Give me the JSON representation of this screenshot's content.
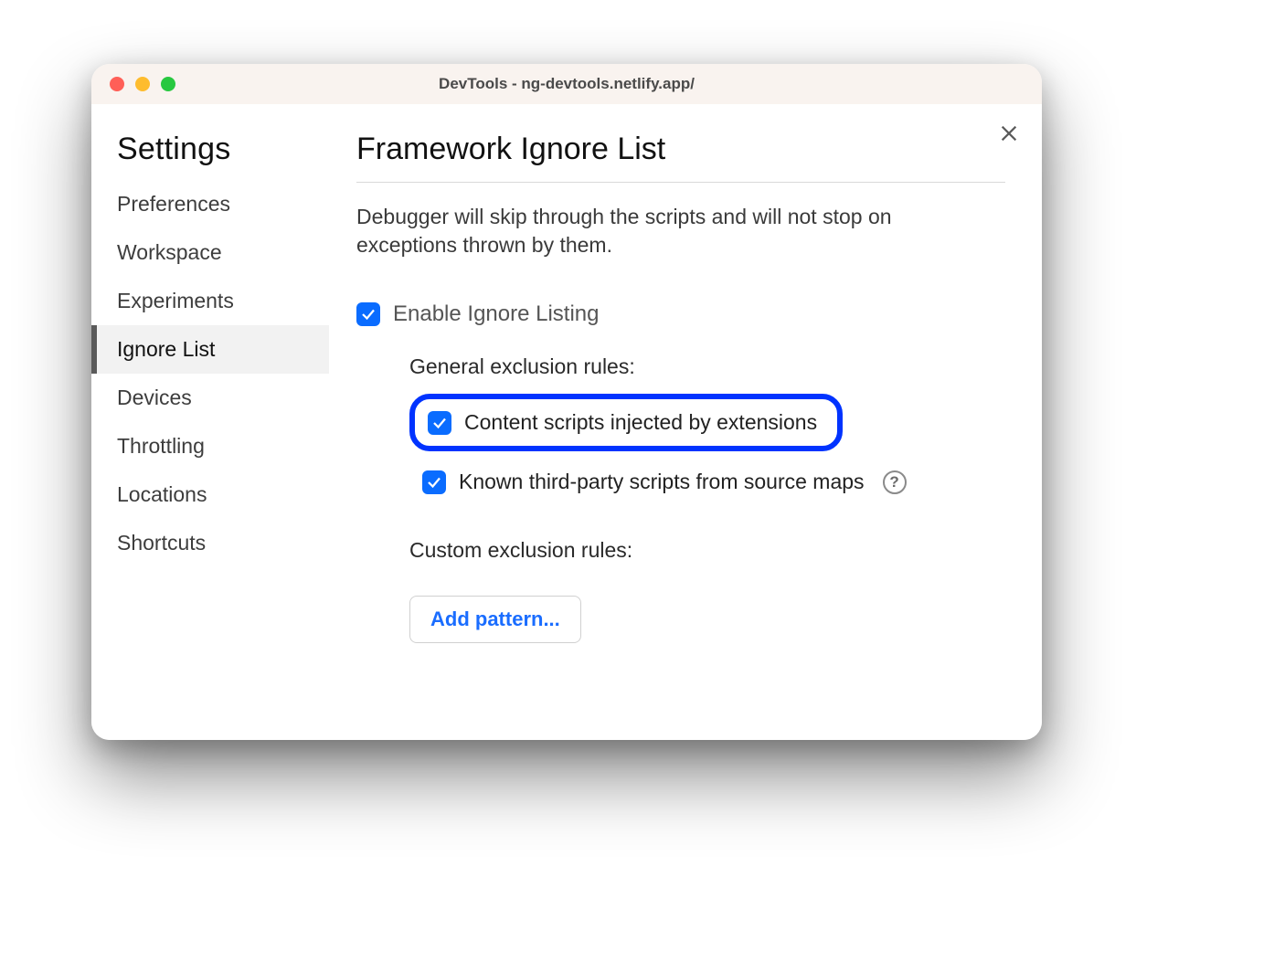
{
  "window": {
    "title": "DevTools - ng-devtools.netlify.app/"
  },
  "sidebar": {
    "title": "Settings",
    "items": [
      {
        "label": "Preferences",
        "active": false
      },
      {
        "label": "Workspace",
        "active": false
      },
      {
        "label": "Experiments",
        "active": false
      },
      {
        "label": "Ignore List",
        "active": true
      },
      {
        "label": "Devices",
        "active": false
      },
      {
        "label": "Throttling",
        "active": false
      },
      {
        "label": "Locations",
        "active": false
      },
      {
        "label": "Shortcuts",
        "active": false
      }
    ]
  },
  "main": {
    "title": "Framework Ignore List",
    "description": "Debugger will skip through the scripts and will not stop on exceptions thrown by them.",
    "enable_label": "Enable Ignore Listing",
    "enable_checked": true,
    "general_heading": "General exclusion rules:",
    "option_content_scripts": {
      "label": "Content scripts injected by extensions",
      "checked": true,
      "highlighted": true
    },
    "option_third_party": {
      "label": "Known third-party scripts from source maps",
      "checked": true,
      "has_help": true
    },
    "custom_heading": "Custom exclusion rules:",
    "add_pattern_label": "Add pattern..."
  },
  "colors": {
    "checkbox_blue": "#0a6cff",
    "highlight_border": "#0033ff",
    "link_blue": "#1a6dff"
  }
}
